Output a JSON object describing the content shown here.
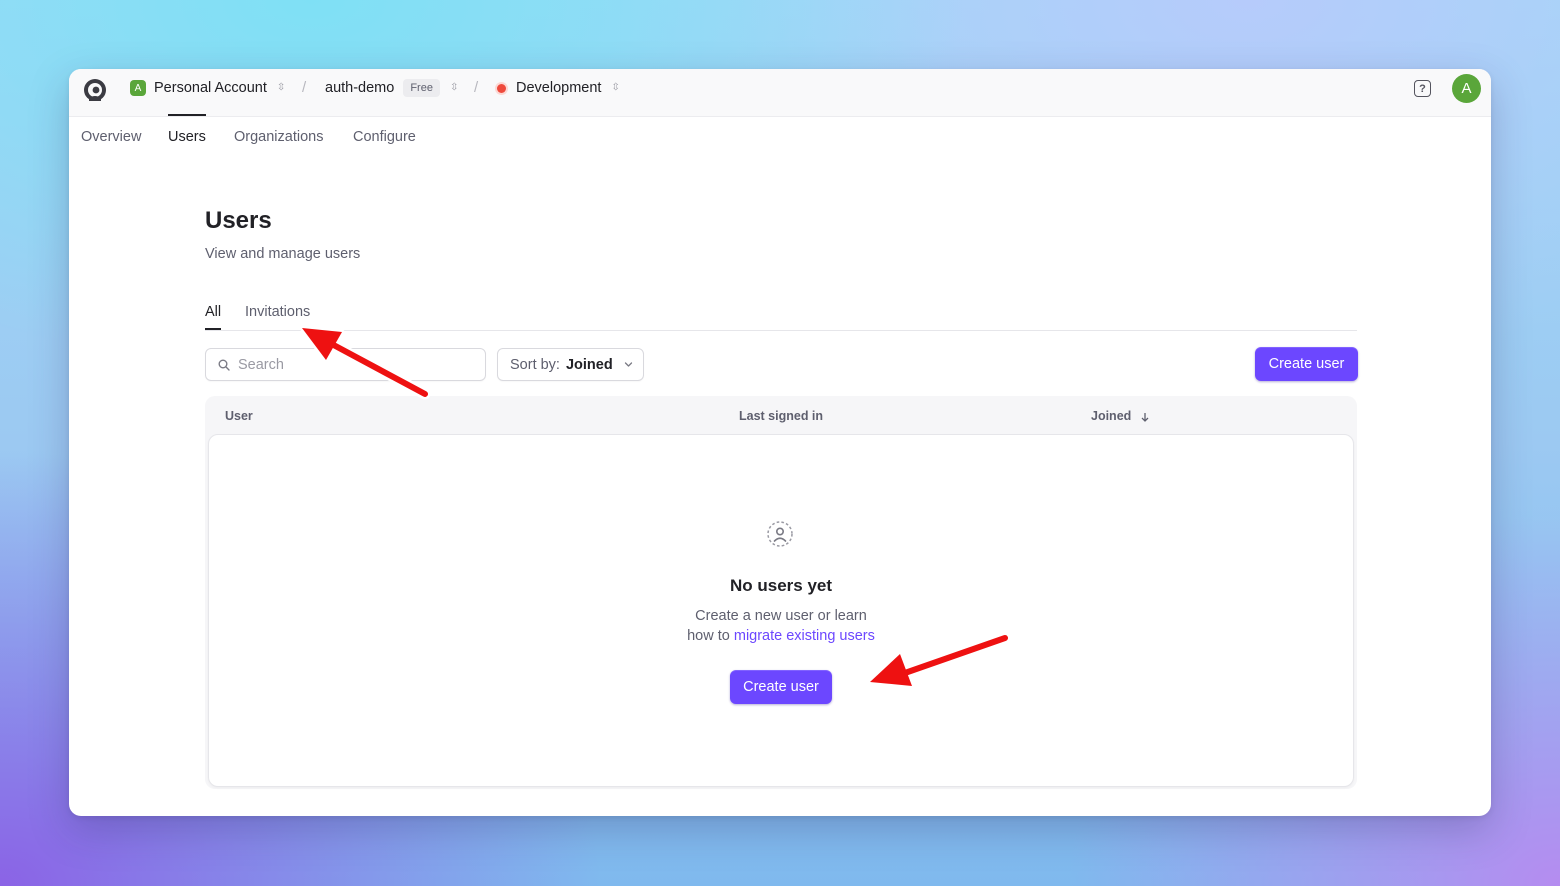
{
  "breadcrumb": {
    "account": {
      "badge": "A",
      "label": "Personal Account"
    },
    "app": {
      "label": "auth-demo",
      "plan": "Free"
    },
    "env": {
      "label": "Development"
    }
  },
  "header": {
    "help_icon": "?",
    "avatar": "A"
  },
  "nav": {
    "tabs": [
      {
        "label": "Overview"
      },
      {
        "label": "Users"
      },
      {
        "label": "Organizations"
      },
      {
        "label": "Configure"
      }
    ],
    "active": "Users"
  },
  "page": {
    "title": "Users",
    "subtitle": "View and manage users"
  },
  "subtabs": [
    {
      "label": "All"
    },
    {
      "label": "Invitations"
    }
  ],
  "search": {
    "placeholder": "Search"
  },
  "sort": {
    "label": "Sort by:",
    "value": "Joined"
  },
  "toolbar": {
    "create_label": "Create user"
  },
  "table": {
    "columns": [
      "User",
      "Last signed in",
      "Joined"
    ]
  },
  "empty": {
    "title": "No users yet",
    "line1": "Create a new user or learn",
    "line2_prefix": "how to ",
    "link": "migrate existing users",
    "button": "Create user"
  },
  "colors": {
    "accent": "#6c47ff",
    "account_badge": "#5aa63a",
    "env_dot": "#ef4a3c",
    "annotation_arrow": "#ee1111"
  }
}
